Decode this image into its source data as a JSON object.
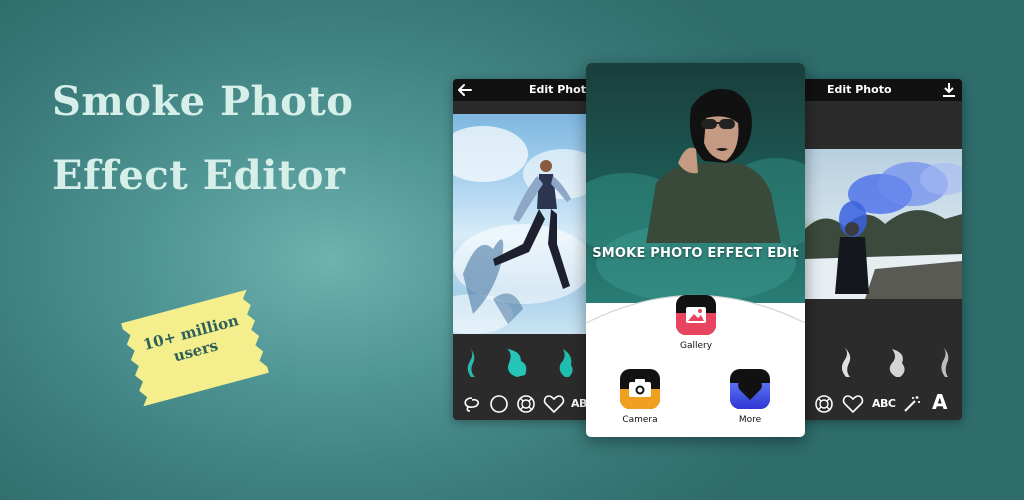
{
  "headline": {
    "line1": "Smoke Photo",
    "line2": "Effect Editor"
  },
  "badge": {
    "line1": "10+ million",
    "line2": "users"
  },
  "screens": {
    "left": {
      "title": "Edit Photo",
      "back_icon": "arrow-left-icon"
    },
    "center": {
      "app_title": "SMOKE PHOTO EFFECT EDIt",
      "menu": [
        {
          "label": "Gallery",
          "icon": "gallery-icon"
        },
        {
          "label": "Camera",
          "icon": "camera-icon"
        },
        {
          "label": "More",
          "icon": "heart-icon"
        }
      ]
    },
    "right": {
      "title": "Edit Photo",
      "download_icon": "download-icon",
      "abc_tool": "ABC",
      "text_tool": "A"
    }
  },
  "colors": {
    "background": "#3f8282",
    "headline": "#d7efe9",
    "badge_fill": "#f4ee8c",
    "badge_text": "#2e5f5b",
    "gallery_icon": "#e8435f",
    "camera_icon": "#f0a020",
    "more_icon": "#3f48e0"
  }
}
